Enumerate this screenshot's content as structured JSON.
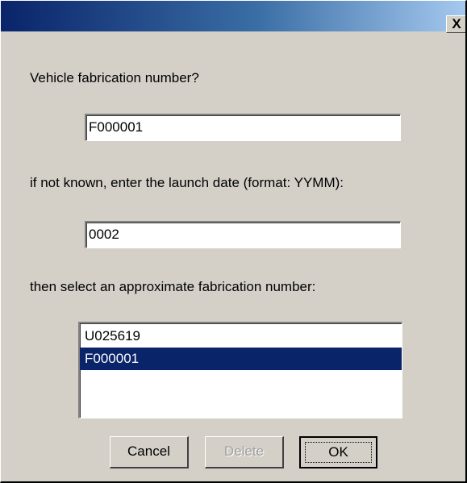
{
  "window": {
    "close_glyph": "X"
  },
  "form": {
    "fab_number_label": "Vehicle fabrication number?",
    "fab_number_value": "F000001",
    "launch_date_label": "if not known, enter the launch date (format: YYMM):",
    "launch_date_value": "0002",
    "approx_label": "then select an approximate fabrication number:",
    "approx_list": [
      {
        "label": "U025619",
        "selected": false
      },
      {
        "label": "F000001",
        "selected": true
      }
    ]
  },
  "buttons": {
    "cancel": "Cancel",
    "delete": "Delete",
    "delete_enabled": false,
    "ok": "OK"
  },
  "colors": {
    "selection": "#0a246a",
    "face": "#d4d0c8"
  }
}
